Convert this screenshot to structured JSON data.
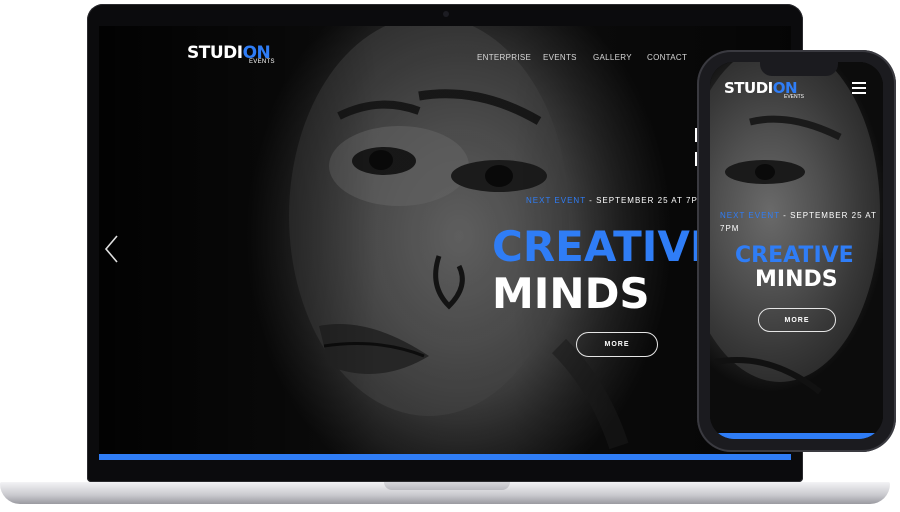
{
  "brand": {
    "logo_main": "STUDI",
    "logo_accent": "ON",
    "logo_sub": "EVENTS"
  },
  "nav": {
    "items": [
      "ENTERPRISE",
      "EVENTS",
      "GALLERY",
      "CONTACT"
    ]
  },
  "hero": {
    "next_event_label": "NEXT EVENT",
    "next_event_date": " - SEPTEMBER 25 AT 7P",
    "headline_line1": "CREATIVE",
    "headline_line2": "MINDS",
    "more_label": "MORE"
  },
  "mobile": {
    "next_event_label": "NEXT EVENT",
    "next_event_date": " - SEPTEMBER 25 AT 7PM",
    "headline_line1": "CREATIVE",
    "headline_line2": "MINDS",
    "more_label": "MORE"
  },
  "icons": {
    "prev": "chevron-left-icon",
    "menu": "hamburger-menu-icon"
  },
  "colors": {
    "accent": "#2f7df6",
    "background": "#000000",
    "text": "#ffffff"
  }
}
